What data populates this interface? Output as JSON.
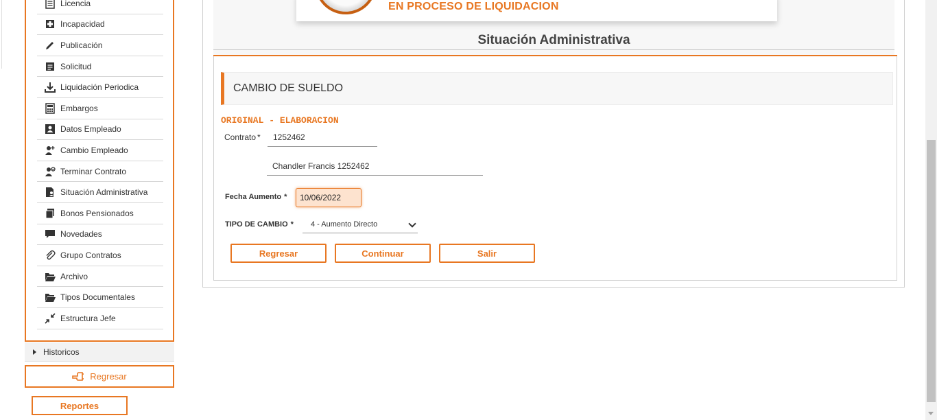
{
  "sidebar": {
    "items": [
      {
        "label": "Licencia",
        "icon": "list-icon"
      },
      {
        "label": "Incapacidad",
        "icon": "medical-book-icon"
      },
      {
        "label": "Publicación",
        "icon": "pencil-icon"
      },
      {
        "label": "Solicitud",
        "icon": "document-icon"
      },
      {
        "label": "Liquidación Periodica",
        "icon": "download-icon"
      },
      {
        "label": "Embargos",
        "icon": "calculator-icon"
      },
      {
        "label": "Datos Empleado",
        "icon": "id-card-icon"
      },
      {
        "label": "Cambio Empleado",
        "icon": "user-change-icon"
      },
      {
        "label": "Terminar Contrato",
        "icon": "user-remove-icon"
      },
      {
        "label": "Situación Administrativa",
        "icon": "doc-user-icon"
      },
      {
        "label": "Bonos Pensionados",
        "icon": "copy-icon"
      },
      {
        "label": "Novedades",
        "icon": "chat-icon"
      },
      {
        "label": "Grupo Contratos",
        "icon": "paperclip-icon"
      },
      {
        "label": "Archivo",
        "icon": "folder-open-icon"
      },
      {
        "label": "Tipos Documentales",
        "icon": "folder-open-icon"
      },
      {
        "label": "Estructura Jefe",
        "icon": "compress-icon"
      }
    ],
    "historicos_label": "Historicos",
    "regresar_label": "Regresar",
    "reportes_label": "Reportes"
  },
  "status": {
    "text": "EN PROCESO DE LIQUIDACION"
  },
  "page": {
    "title": "Situación Administrativa"
  },
  "form": {
    "header": "CAMBIO DE SUELDO",
    "doc_state": "ORIGINAL - ELABORACION",
    "contrato_label": "Contrato",
    "contrato_value": "1252462",
    "nombre_value": "Chandler Francis 1252462",
    "fecha_label": "Fecha Aumento",
    "fecha_value": "10/06/2022",
    "tipo_label": "TIPO DE CAMBIO",
    "tipo_selected": "4 - Aumento Directo",
    "required_mark": "*"
  },
  "buttons": {
    "regresar": "Regresar",
    "continuar": "Continuar",
    "salir": "Salir"
  },
  "colors": {
    "accent": "#e87722"
  }
}
